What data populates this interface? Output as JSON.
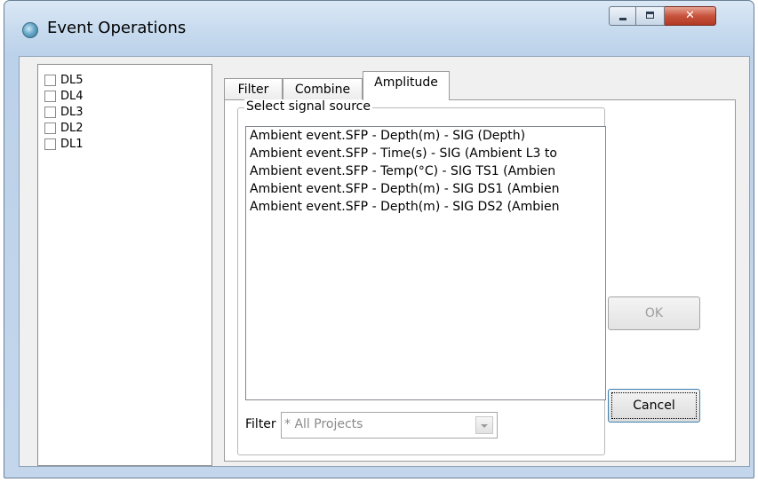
{
  "window": {
    "title": "Event Operations",
    "icon": "globe-icon",
    "controls": {
      "minimize": "minimize-icon",
      "maximize": "maximize-icon",
      "close": "✕"
    }
  },
  "tree": {
    "items": [
      {
        "label": "DL5",
        "checked": false
      },
      {
        "label": "DL4",
        "checked": false
      },
      {
        "label": "DL3",
        "checked": false
      },
      {
        "label": "DL2",
        "checked": false
      },
      {
        "label": "DL1",
        "checked": false
      }
    ]
  },
  "tabs": [
    {
      "label": "Filter",
      "active": false
    },
    {
      "label": "Combine",
      "active": false
    },
    {
      "label": "Amplitude",
      "active": true
    }
  ],
  "signal_source": {
    "title": "Select signal source",
    "items": [
      "Ambient event.SFP - Depth(m) - SIG  (Depth)",
      "Ambient event.SFP - Time(s) - SIG  (Ambient L3 to",
      "Ambient event.SFP - Temp(°C) - SIG TS1 (Ambien",
      "Ambient event.SFP - Depth(m) - SIG DS1 (Ambien",
      "Ambient event.SFP - Depth(m) - SIG DS2 (Ambien"
    ]
  },
  "filter": {
    "label": "Filter",
    "value": "* All Projects"
  },
  "buttons": {
    "ok": "OK",
    "cancel": "Cancel"
  }
}
